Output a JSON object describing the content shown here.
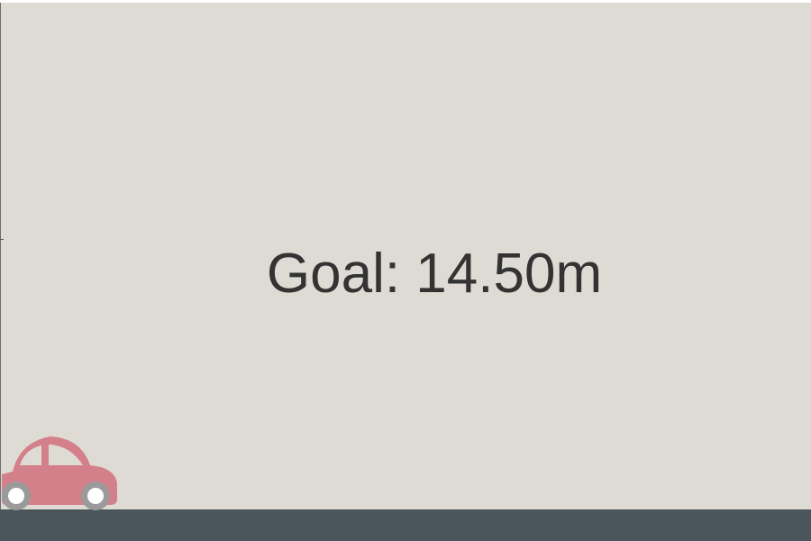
{
  "game": {
    "goal_label": "Goal: 14.50m"
  },
  "colors": {
    "background": "#dedbd4",
    "road": "#4a565b",
    "car_body": "#d4808a",
    "car_window": "#dedbd4",
    "wheel_tire": "#9a9a9a",
    "wheel_hub": "#ffffff",
    "text": "#333333"
  },
  "icons": {
    "car": "car-icon"
  }
}
